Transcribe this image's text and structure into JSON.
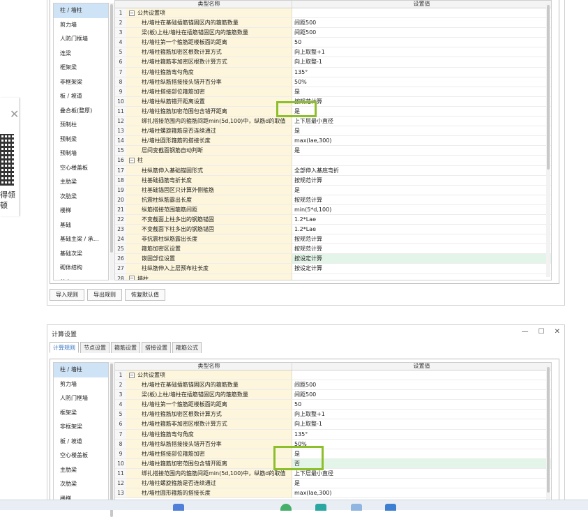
{
  "window": {
    "title": "计算设置",
    "controls": [
      "—",
      "☐",
      "✕"
    ]
  },
  "tabs": [
    "计算规则",
    "节点设置",
    "箍筋设置",
    "搭接设置",
    "箍筋公式"
  ],
  "left_panel": {
    "close": "✕",
    "text": "得领\n顿"
  },
  "sidebar_top": [
    "柱 / 墙柱",
    "剪力墙",
    "人防门框墙",
    "连梁",
    "框架梁",
    "非框架梁",
    "板 / 坡道",
    "叠合板(整厚)",
    "预制柱",
    "预制梁",
    "预制墙",
    "空心楼盖板",
    "主肋梁",
    "次肋梁",
    "楼梯",
    "基础",
    "基础主梁 / 承…",
    "基础次梁",
    "砌体结构",
    "其它"
  ],
  "sidebar_bottom": [
    "柱 / 墙柱",
    "剪力墙",
    "人防门框墙",
    "框架梁",
    "非框架梁",
    "板 / 坡道",
    "空心楼盖板",
    "主肋梁",
    "次肋梁",
    "楼梯"
  ],
  "grid_header": {
    "name": "类型名称",
    "value": "设置值"
  },
  "rows_top": [
    {
      "n": "1",
      "name": "公共设置项",
      "value": "",
      "group": true
    },
    {
      "n": "2",
      "name": "柱/墙柱在基础插筋锚固区内的箍筋数量",
      "value": "间距500"
    },
    {
      "n": "3",
      "name": "梁(板)上柱/墙柱在插筋锚固区内的箍筋数量",
      "value": "间距500"
    },
    {
      "n": "4",
      "name": "柱/墙柱第一个箍筋距楼板面的距离",
      "value": "50"
    },
    {
      "n": "5",
      "name": "柱/墙柱箍筋加密区根数计算方式",
      "value": "向上取整+1"
    },
    {
      "n": "6",
      "name": "柱/墙柱箍筋非加密区根数计算方式",
      "value": "向上取整-1"
    },
    {
      "n": "7",
      "name": "柱/墙柱箍筋弯勾角度",
      "value": "135°"
    },
    {
      "n": "8",
      "name": "柱/墙柱纵筋搭接接头错开百分率",
      "value": "50%"
    },
    {
      "n": "9",
      "name": "柱/墙柱搭接部位箍筋加密",
      "value": "是"
    },
    {
      "n": "10",
      "name": "柱/墙柱纵筋错开距离设置",
      "value": "按规范计算"
    },
    {
      "n": "11",
      "name": "柱/墙柱箍筋加密范围包含错开距离",
      "value": "是"
    },
    {
      "n": "12",
      "name": "绑扎搭接范围内的箍筋间距min(5d,100)中，纵筋d的取值",
      "value": "上下层最小直径"
    },
    {
      "n": "13",
      "name": "柱/墙柱螺旋箍筋是否连续通过",
      "value": "是"
    },
    {
      "n": "14",
      "name": "柱/墙柱圆形箍筋的搭接长度",
      "value": "max(lae,300)"
    },
    {
      "n": "15",
      "name": "层间变截面钢筋自动判断",
      "value": "是"
    },
    {
      "n": "16",
      "name": "柱",
      "value": "",
      "group": true
    },
    {
      "n": "17",
      "name": "柱纵筋伸入基础锚固形式",
      "value": "全部伸入基底弯折"
    },
    {
      "n": "18",
      "name": "柱基础插筋弯折长度",
      "value": "按规范计算"
    },
    {
      "n": "19",
      "name": "柱基础锚固区只计算外侧箍筋",
      "value": "是"
    },
    {
      "n": "20",
      "name": "抗震柱纵筋露出长度",
      "value": "按规范计算"
    },
    {
      "n": "21",
      "name": "纵筋搭接范围箍筋间距",
      "value": "min(5*d,100)"
    },
    {
      "n": "22",
      "name": "不变截面上柱多出的钢筋锚固",
      "value": "1.2*Lae"
    },
    {
      "n": "23",
      "name": "不变截面下柱多出的钢筋锚固",
      "value": "1.2*Lae"
    },
    {
      "n": "24",
      "name": "非抗震柱纵筋露出长度",
      "value": "按规范计算"
    },
    {
      "n": "25",
      "name": "箍筋加密区设置",
      "value": "按规范计算"
    },
    {
      "n": "26",
      "name": "嵌固部位设置",
      "value": "按设定计算",
      "hl": true
    },
    {
      "n": "27",
      "name": "柱纵筋伸入上层预布柱长度",
      "value": "按设定计算"
    },
    {
      "n": "28",
      "name": "墙柱",
      "value": "",
      "group": true
    }
  ],
  "rows_bottom": [
    {
      "n": "1",
      "name": "公共设置项",
      "value": "",
      "group": true
    },
    {
      "n": "2",
      "name": "柱/墙柱在基础插筋锚固区内的箍筋数量",
      "value": "间距500"
    },
    {
      "n": "3",
      "name": "梁(板)上柱/墙柱在插筋锚固区内的箍筋数量",
      "value": "间距500"
    },
    {
      "n": "4",
      "name": "柱/墙柱第一个箍筋距楼板面的距离",
      "value": "50"
    },
    {
      "n": "5",
      "name": "柱/墙柱箍筋加密区根数计算方式",
      "value": "向上取整+1"
    },
    {
      "n": "6",
      "name": "柱/墙柱箍筋非加密区根数计算方式",
      "value": "向上取整-1"
    },
    {
      "n": "7",
      "name": "柱/墙柱箍筋弯勾角度",
      "value": "135°"
    },
    {
      "n": "8",
      "name": "柱/墙柱纵筋搭接接头错开百分率",
      "value": "50%"
    },
    {
      "n": "9",
      "name": "柱/墙柱搭接部位箍筋加密",
      "value": "是"
    },
    {
      "n": "10",
      "name": "柱/墙柱箍筋加密范围包含错开距离",
      "value": "否",
      "hl": true
    },
    {
      "n": "11",
      "name": "绑扎搭接范围内的箍筋间距min(5d,100)中，纵筋d的取值",
      "value": "上下层最小直径"
    },
    {
      "n": "12",
      "name": "柱/墙柱螺旋箍筋是否连续通过",
      "value": "是"
    },
    {
      "n": "13",
      "name": "柱/墙柱圆形箍筋的搭接长度",
      "value": "max(lae,300)"
    }
  ],
  "buttons": [
    "导入规则",
    "导出规则",
    "恢复默认值"
  ]
}
